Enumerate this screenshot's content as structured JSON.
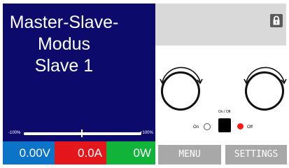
{
  "status": {
    "line1": "Master-Slave-",
    "line2": "Modus",
    "line3": "Slave 1"
  },
  "bar": {
    "left_label": "-100%",
    "right_label": "+100%",
    "level": 1.0
  },
  "readouts": {
    "voltage": "0.00V",
    "current": "0.0A",
    "power": "0W"
  },
  "controls": {
    "onoff_label": "On / Off",
    "on_label": "On",
    "off_label": "Off"
  },
  "softkeys": {
    "menu": "MENU",
    "settings": "SETTINGS"
  },
  "colors": {
    "panel": "#0c0b6b",
    "voltage": "#0c74c8",
    "current": "#e3171b",
    "power": "#12b339",
    "button": "#a8a8a8",
    "off_led": "#ff1a1a"
  },
  "icons": {
    "lock": "lock-icon",
    "knob": "rotary-knob-icon"
  }
}
